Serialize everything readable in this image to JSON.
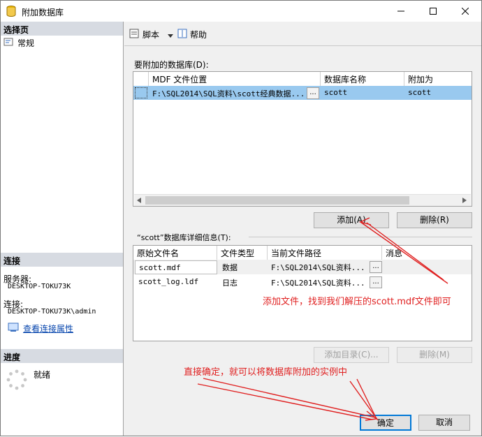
{
  "window": {
    "title": "附加数据库"
  },
  "sidebar": {
    "select_page_header": "选择页",
    "page_general": "常规",
    "connection_header": "连接",
    "server_label": "服务器:",
    "server_value": "DESKTOP-TOKU73K",
    "connection_label": "连接:",
    "connection_value": "DESKTOP-TOKU73K\\admin",
    "view_props_link": "查看连接属性",
    "progress_header": "进度",
    "progress_status": "就绪"
  },
  "toolbar": {
    "script_label": "脚本",
    "help_label": "帮助"
  },
  "main": {
    "attach_label": "要附加的数据库(D):",
    "db_grid": {
      "columns": [
        "MDF 文件位置",
        "数据库名称",
        "附加为"
      ],
      "rows": [
        {
          "mdf": "F:\\SQL2014\\SQL资料\\scott经典数据...",
          "db_name": "scott",
          "attach_as": "scott"
        }
      ]
    },
    "add_button": "添加(A)",
    "remove_button": "删除(R)",
    "details_label": "“scott”数据库详细信息(T):",
    "detail_grid": {
      "columns": [
        "原始文件名",
        "文件类型",
        "当前文件路径",
        "消息"
      ],
      "rows": [
        {
          "name": "scott.mdf",
          "type": "数据",
          "path": "F:\\SQL2014\\SQL资料..."
        },
        {
          "name": "scott_log.ldf",
          "type": "日志",
          "path": "F:\\SQL2014\\SQL资料..."
        }
      ]
    },
    "add_catalog_button": "添加目录(C)...",
    "remove_detail_button": "删除(M)"
  },
  "footer": {
    "ok_button": "确定",
    "cancel_button": "取消"
  },
  "annotations": {
    "note1": "添加文件，找到我们解压的scott.mdf文件即可",
    "note2": "直接确定，就可以将数据库附加的实例中"
  }
}
